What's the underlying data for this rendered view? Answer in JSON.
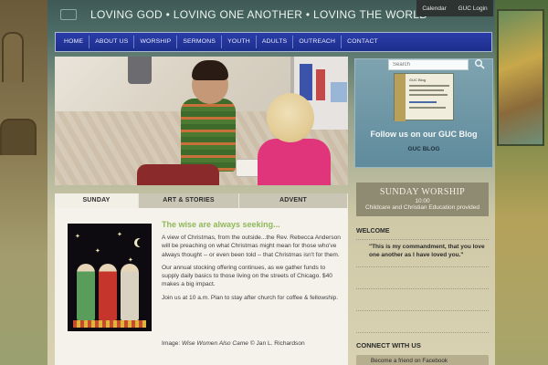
{
  "header": {
    "tagline": "LOVING GOD • LOVING ONE ANOTHER • LOVING THE WORLD",
    "top_links": [
      "Calendar",
      "GUC Login"
    ]
  },
  "nav": {
    "items": [
      "HOME",
      "ABOUT US",
      "WORSHIP",
      "SERMONS",
      "YOUTH",
      "ADULTS",
      "OUTREACH",
      "CONTACT"
    ]
  },
  "tabs": {
    "items": [
      "SUNDAY",
      "ART & STORIES",
      "ADVENT"
    ],
    "active": "SUNDAY"
  },
  "post": {
    "title": "The wise are always seeking...",
    "paragraphs": [
      "A view of Christmas, from the outside...the Rev. Rebecca Anderson will be preaching on what Christmas might mean for those who've always thought -- or even been told -- that Christmas isn't for them.",
      "Our annual stocking offering continues, as we gather funds to supply daily basics to those living on the streets of Chicago.  $40 makes a big impact.",
      "Join us at 10 a.m. Plan to stay after church for coffee & fellowship."
    ],
    "caption_prefix": "Image: ",
    "caption_title": "Wise Women Also Came",
    "caption_suffix": " © Jan L. Richardson"
  },
  "sidebar": {
    "search_placeholder": "Search",
    "blog_thumb_title": "GUC Blog",
    "blog_heading": "Follow us on our GUC Blog",
    "blog_link": "GUC BLOG",
    "worship_title": "SUNDAY WORSHIP",
    "worship_time": "10:00",
    "worship_note": "Childcare and Christian Education provided",
    "welcome_heading": "WELCOME",
    "quote": "\"This is my commandment, that you love one another as I have loved you.\"",
    "connect_heading": "CONNECT WITH US",
    "facebook_link": "Become a friend on Facebook"
  },
  "colors": {
    "nav_bg": "#1e2e8e",
    "post_title": "#8fb95a",
    "blog_box": "#5f8b9c",
    "worship_box": "#8f8a72"
  }
}
